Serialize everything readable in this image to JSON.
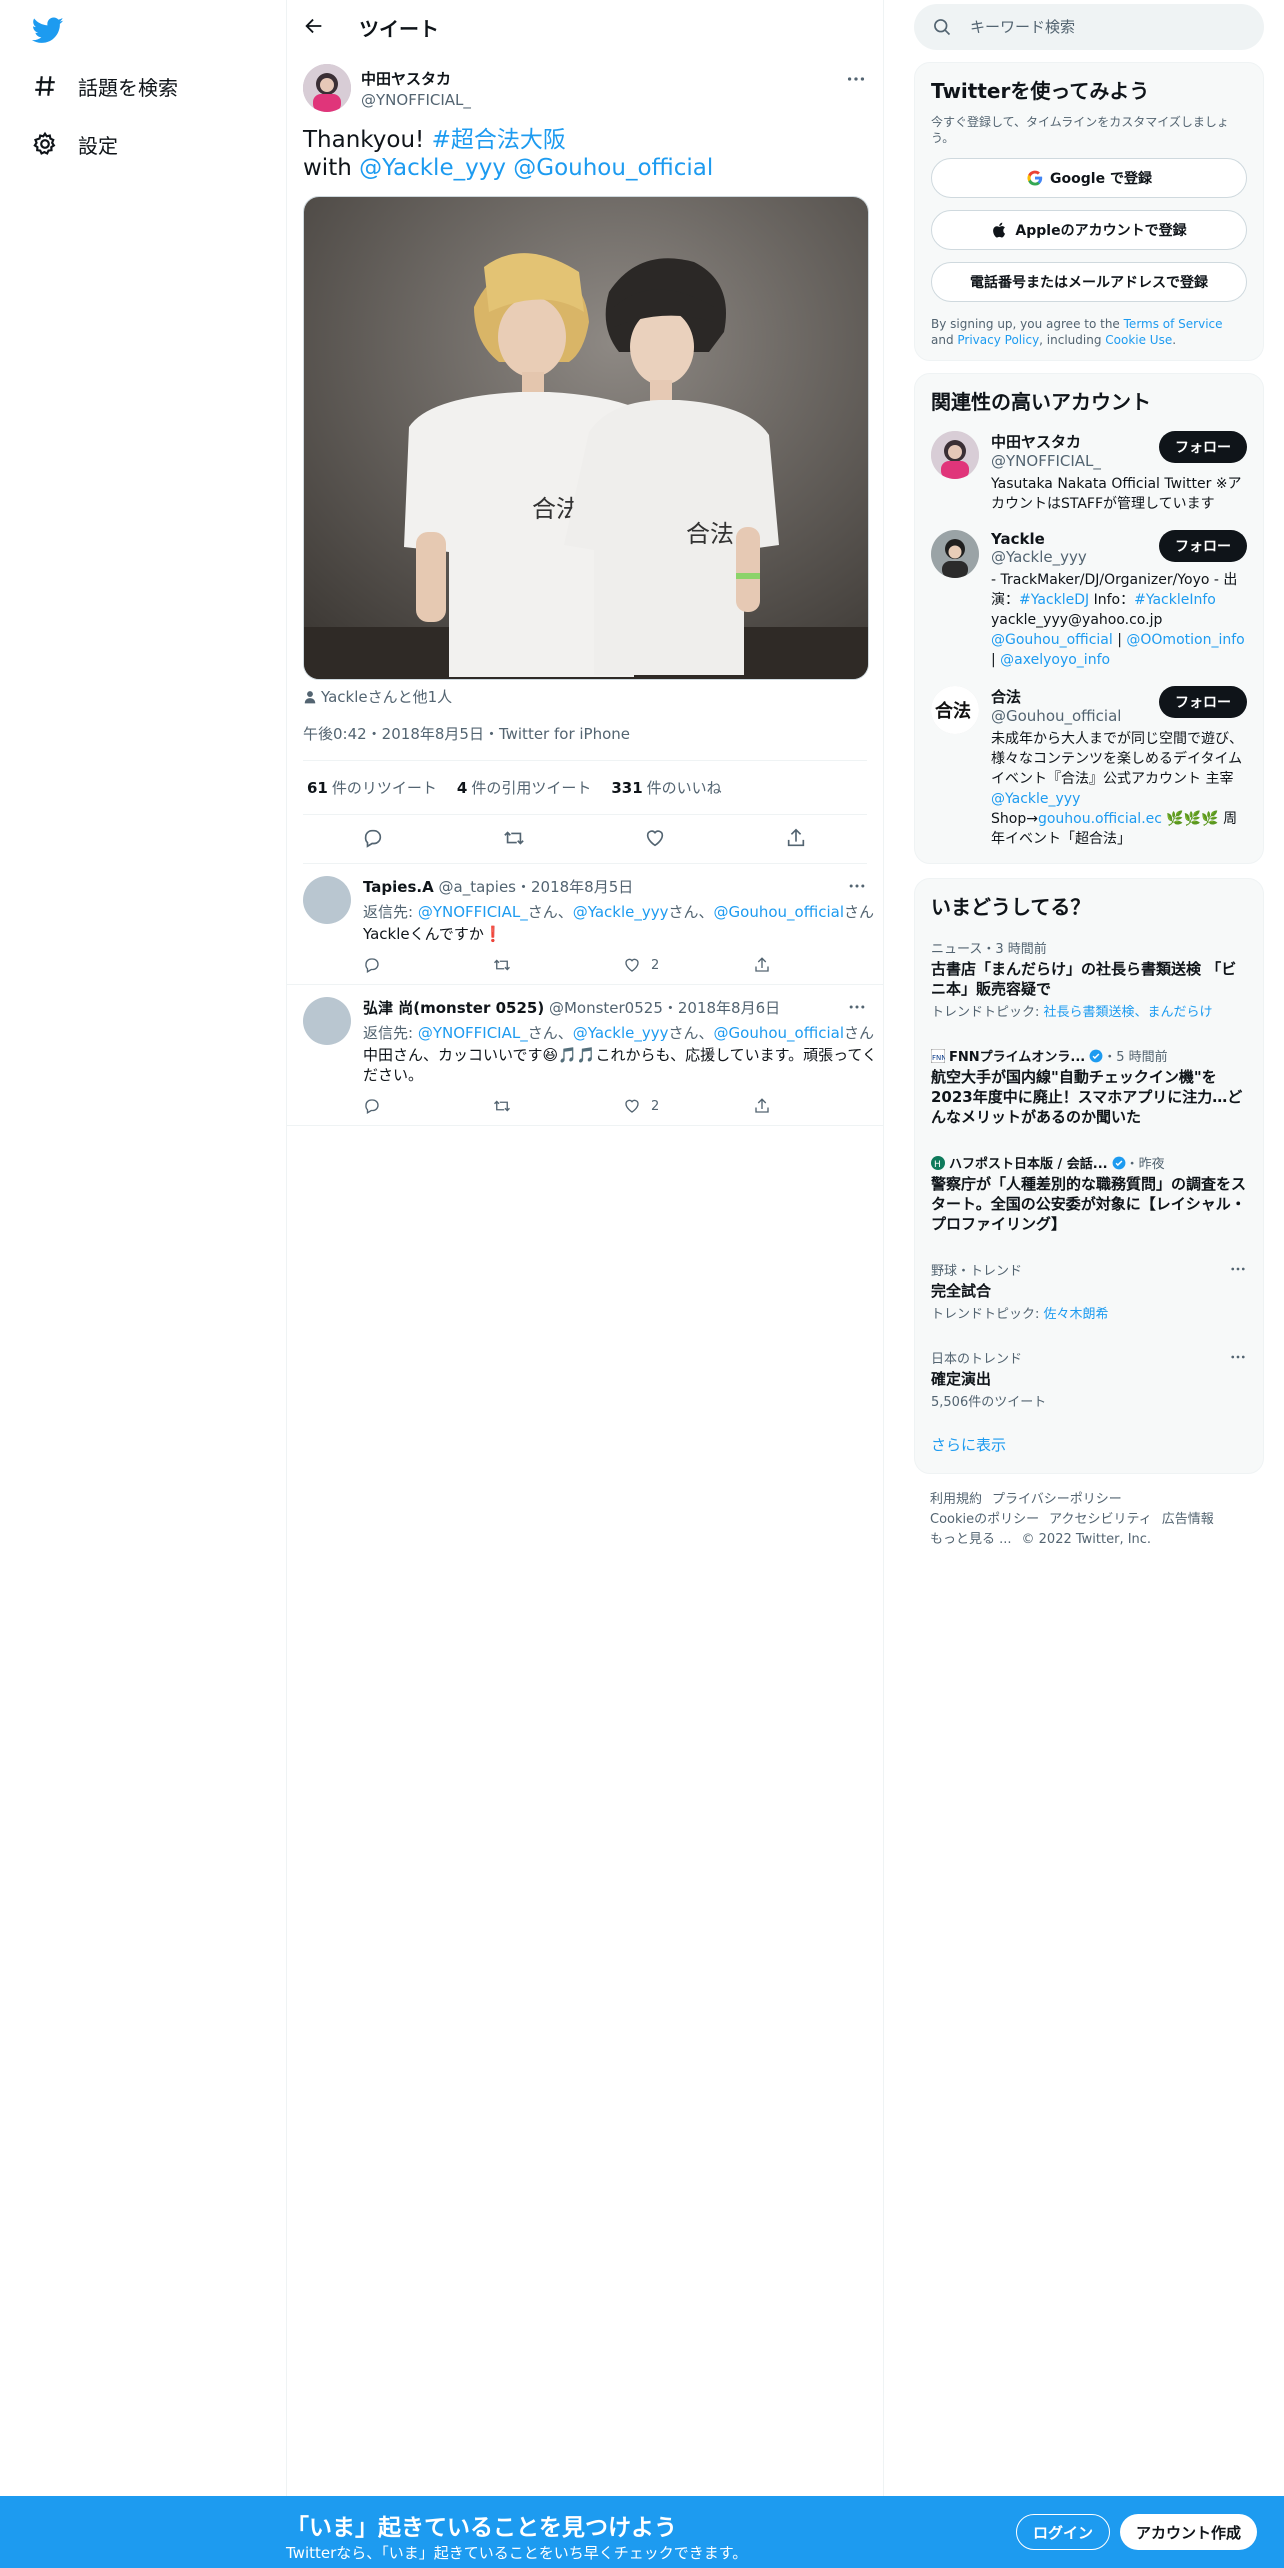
{
  "nav": {
    "explore": "話題を検索",
    "settings": "設定"
  },
  "header": {
    "title": "ツイート"
  },
  "tweet": {
    "author_name": "中田ヤスタカ",
    "author_handle": "@YNOFFICIAL_",
    "text_prefix": "Thankyou! ",
    "hashtag": "#超合法大阪",
    "with_label": "with ",
    "mention1": "@Yackle_yyy",
    "mention2": "@Gouhou_official",
    "tagged": "Yackleさんと他1人",
    "timestamp": "午後0:42・2018年8月5日・Twitter for iPhone",
    "retweets_count": "61",
    "retweets_label": "件のリツイート",
    "quotes_count": "4",
    "quotes_label": "件の引用ツイート",
    "likes_count": "331",
    "likes_label": "件のいいね"
  },
  "replies": [
    {
      "name": "Tapies.A",
      "handle": "@a_tapies",
      "date": "・2018年8月5日",
      "to_prefix": "返信先: ",
      "to1": "@YNOFFICIAL_",
      "to2": "@Yackle_yyy",
      "to3": "@Gouhou_official",
      "san": "さん",
      "text": "Yackleくんですか❗",
      "likes": "2"
    },
    {
      "name": "弘津 尚(monster 0525)",
      "handle": "@Monster0525",
      "date": "・2018年8月6日",
      "to_prefix": "返信先: ",
      "to1": "@YNOFFICIAL_",
      "to2": "@Yackle_yyy",
      "to3": "@Gouhou_official",
      "san": "さん",
      "text": "中田さん、カッコいいです😆🎵🎵これからも、応援しています。頑張ってください。",
      "likes": "2"
    }
  ],
  "search": {
    "placeholder": "キーワード検索"
  },
  "signup_card": {
    "title": "Twitterを使ってみよう",
    "subtitle": "今すぐ登録して、タイムラインをカスタマイズしましょう。",
    "google": "Google で登録",
    "apple": "Appleのアカウントで登録",
    "phone": "電話番号またはメールアドレスで登録",
    "legal_1": "By signing up, you agree to the ",
    "tos": "Terms of Service",
    "legal_2": " and ",
    "privacy": "Privacy Policy",
    "legal_3": ", including ",
    "cookie": "Cookie Use",
    "legal_4": "."
  },
  "related": {
    "title": "関連性の高いアカウント",
    "follow_label": "フォロー",
    "accounts": [
      {
        "name": "中田ヤスタカ",
        "handle": "@YNOFFICIAL_",
        "bio": "Yasutaka Nakata Official Twitter ※アカウントはSTAFFが管理しています"
      },
      {
        "name": "Yackle",
        "handle": "@Yackle_yyy",
        "bio_1": "- TrackMaker/DJ/Organizer/Yoyo - 出演：",
        "bio_tag1": "#YackleDJ",
        "bio_2": " Info：",
        "bio_tag2": "#YackleInfo",
        "bio_3": " yackle_yyy@yahoo.co.jp ",
        "bio_m1": "@Gouhou_official",
        "bio_sep1": " | ",
        "bio_m2": "@OOmotion_info",
        "bio_sep2": " | ",
        "bio_m3": "@axelyoyo_info"
      },
      {
        "name": "合法",
        "handle": "@Gouhou_official",
        "bio_1": "未成年から大人までが同じ空間で遊び、様々なコンテンツを楽しめるデイタイムイベント『合法』公式アカウント 主宰 ",
        "bio_m1": "@Yackle_yyy",
        "bio_2": " Shop→",
        "bio_link": "gouhou.official.ec",
        "bio_3": " 🌿🌿🌿 周年イベント「超合法」"
      }
    ]
  },
  "trends": {
    "title": "いまどうしてる？",
    "items": [
      {
        "meta": "ニュース・3 時間前",
        "title": "古書店「まんだらけ」の社長ら書類送検 「ビニ本」販売容疑で",
        "sub_label": "トレンドトピック: ",
        "sub_link": "社長ら書類送検、まんだらけ"
      },
      {
        "meta_source": "FNNプライムオンラ...",
        "meta_time": "・5 時間前",
        "title": "航空大手が国内線\"自動チェックイン機\"を2023年度中に廃止！スマホアプリに注力…どんなメリットがあるのか聞いた"
      },
      {
        "meta_source": "ハフポスト日本版 / 会話...",
        "meta_time": "・昨夜",
        "title": "警察庁が「人種差別的な職務質問」の調査をスタート。全国の公安委が対象に【レイシャル・プロファイリング】"
      },
      {
        "meta": "野球・トレンド",
        "title": "完全試合",
        "sub_label": "トレンドトピック: ",
        "sub_link": "佐々木朗希"
      },
      {
        "meta": "日本のトレンド",
        "title": "確定演出",
        "sub": "5,506件のツイート"
      }
    ],
    "show_more": "さらに表示"
  },
  "footer": {
    "links": [
      "利用規約",
      "プライバシーポリシー",
      "Cookieのポリシー",
      "アクセシビリティ",
      "広告情報",
      "もっと見る ..."
    ],
    "copyright": "© 2022 Twitter, Inc."
  },
  "bottom": {
    "title": "「いま」起きていることを見つけよう",
    "subtitle": "Twitterなら、「いま」起きていることをいち早くチェックできます。",
    "login": "ログイン",
    "signup": "アカウント作成"
  },
  "colors": {
    "accent": "#1d9bf0",
    "text": "#0f1419",
    "muted": "#536471"
  }
}
